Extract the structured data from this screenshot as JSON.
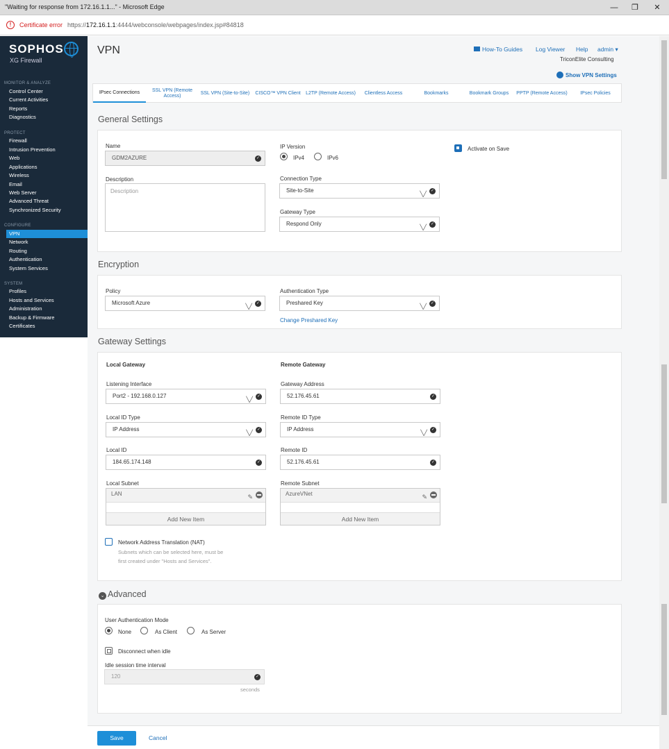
{
  "window": {
    "title": "\"Waiting for response from 172.16.1.1...\" - Microsoft Edge",
    "minimize": "—",
    "restore": "❐",
    "close": "✕"
  },
  "address": {
    "cert_error": "Certificate error",
    "url_prefix": "https://",
    "url_host": "172.16.1.1",
    "url_rest": ":4444/webconsole/webpages/index.jsp#84818"
  },
  "sidebar": {
    "brand": "SOPHOS",
    "product": "XG Firewall",
    "sections": {
      "monitor": "MONITOR & ANALYZE",
      "protect": "PROTECT",
      "configure": "CONFIGURE",
      "system": "SYSTEM"
    },
    "monitor_items": [
      "Control Center",
      "Current Activities",
      "Reports",
      "Diagnostics"
    ],
    "protect_items": [
      "Firewall",
      "Intrusion Prevention",
      "Web",
      "Applications",
      "Wireless",
      "Email",
      "Web Server",
      "Advanced Threat",
      "Synchronized Security"
    ],
    "configure_items": [
      "VPN",
      "Network",
      "Routing",
      "Authentication",
      "System Services"
    ],
    "system_items": [
      "Profiles",
      "Hosts and Services",
      "Administration",
      "Backup & Firmware",
      "Certificates"
    ]
  },
  "header": {
    "title": "VPN",
    "howto": "How-To Guides",
    "logviewer": "Log Viewer",
    "help": "Help",
    "admin": "admin ▾",
    "org": "TriconElite Consulting",
    "show_vpn": "Show VPN Settings"
  },
  "tabs": [
    "IPsec Connections",
    "SSL VPN (Remote Access)",
    "SSL VPN (Site-to-Site)",
    "CISCO™ VPN Client",
    "L2TP (Remote Access)",
    "Clientless Access",
    "Bookmarks",
    "Bookmark Groups",
    "PPTP (Remote Access)",
    "IPsec Policies"
  ],
  "general": {
    "title": "General Settings",
    "name_label": "Name",
    "name_value": "GDM2AZURE",
    "desc_label": "Description",
    "desc_placeholder": "Description",
    "ipversion_label": "IP Version",
    "ipv4": "IPv4",
    "ipv6": "IPv6",
    "activate": "Activate on Save",
    "conntype_label": "Connection Type",
    "conntype_value": "Site-to-Site",
    "gwtype_label": "Gateway Type",
    "gwtype_value": "Respond Only"
  },
  "encryption": {
    "title": "Encryption",
    "policy_label": "Policy",
    "policy_value": "Microsoft Azure",
    "authtype_label": "Authentication Type",
    "authtype_value": "Preshared Key",
    "change_key": "Change Preshared Key"
  },
  "gateway": {
    "title": "Gateway Settings",
    "local_head": "Local Gateway",
    "remote_head": "Remote Gateway",
    "listen_label": "Listening Interface",
    "listen_value": "Port2 - 192.168.0.127",
    "gwaddr_label": "Gateway Address",
    "gwaddr_value": "52.176.45.61",
    "localidtype_label": "Local ID Type",
    "localidtype_value": "IP Address",
    "remoteidtype_label": "Remote ID Type",
    "remoteidtype_value": "IP Address",
    "localid_label": "Local ID",
    "localid_value": "184.65.174.148",
    "remoteid_label": "Remote ID",
    "remoteid_value": "52.176.45.61",
    "localsubnet_label": "Local Subnet",
    "localsubnet_item": "LAN",
    "remotesubnet_label": "Remote Subnet",
    "remotesubnet_item": "AzureVNet",
    "add_item": "Add New Item",
    "nat_label": "Network Address Translation (NAT)",
    "nat_hint1": "Subnets which can be selected here, must be",
    "nat_hint2": "first created under \"Hosts and Services\"."
  },
  "advanced": {
    "title": "Advanced",
    "uam_label": "User Authentication Mode",
    "none": "None",
    "as_client": "As Client",
    "as_server": "As Server",
    "disconnect": "Disconnect when idle",
    "idle_label": "Idle session time interval",
    "idle_value": "120",
    "seconds": "seconds"
  },
  "footer": {
    "save": "Save",
    "cancel": "Cancel"
  }
}
